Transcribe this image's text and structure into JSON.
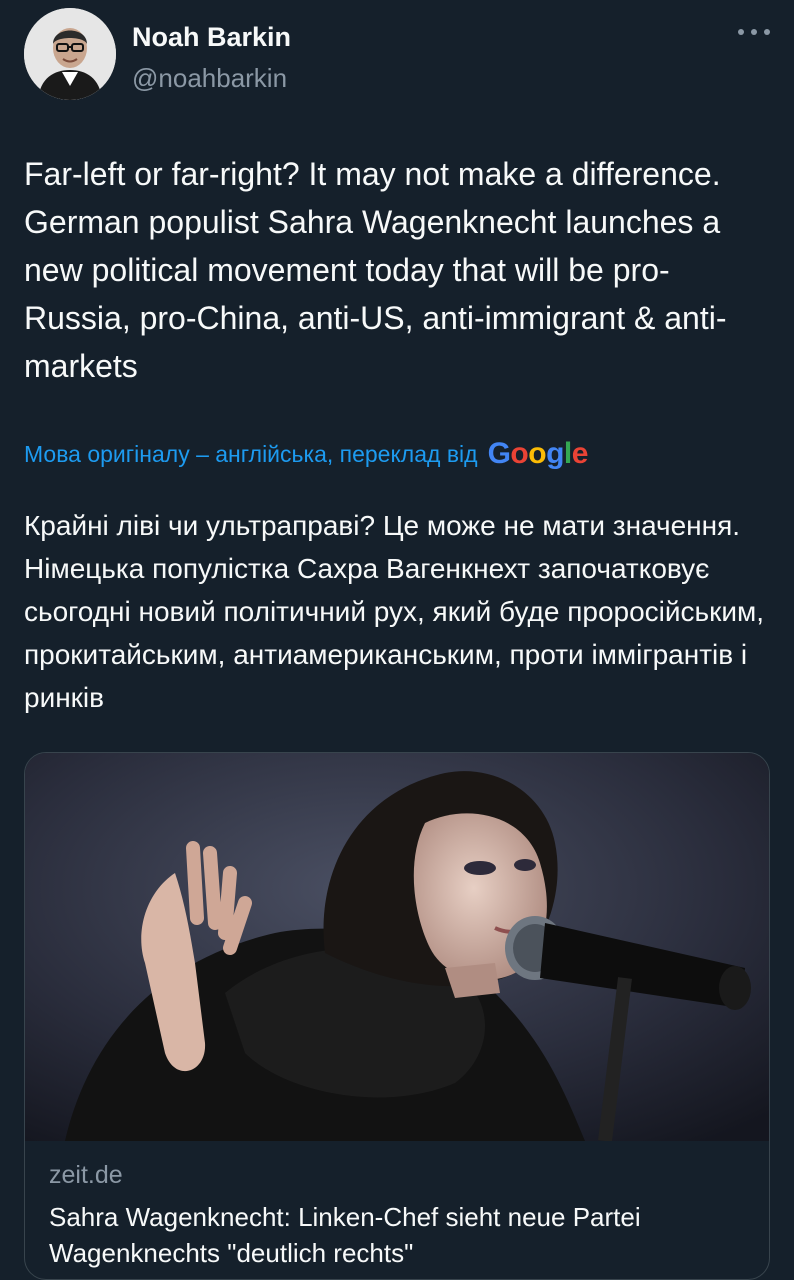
{
  "author": {
    "name": "Noah Barkin",
    "handle": "@noahbarkin",
    "avatar_icon": "profile-photo"
  },
  "more_icon": "more-dots-icon",
  "tweet": {
    "text": "Far-left or far-right? It may not make a difference. German populist Sahra Wagenknecht launches a new political movement today that will be pro-Russia, pro-China, anti-US, anti-immigrant & anti-markets",
    "translation_label": "Мова оригіналу – англійська, переклад від",
    "translation_provider": "Google",
    "translated_text": "Крайні ліві чи ультраправі? Це може не мати значення. Німецька популістка Сахра Вагенкнехт започатковує сьогодні новий політичний рух, який буде проросійським, прокитайським, антиамериканським, проти іммігрантів і ринків"
  },
  "card": {
    "domain": "zeit.de",
    "title": "Sahra Wagenknecht: Linken-Chef sieht neue Partei Wagenknechts \"deutlich rechts\""
  },
  "colors": {
    "background": "#15202b",
    "link": "#1d9bf0",
    "secondary_text": "#8b98a5",
    "border": "#38444d"
  }
}
